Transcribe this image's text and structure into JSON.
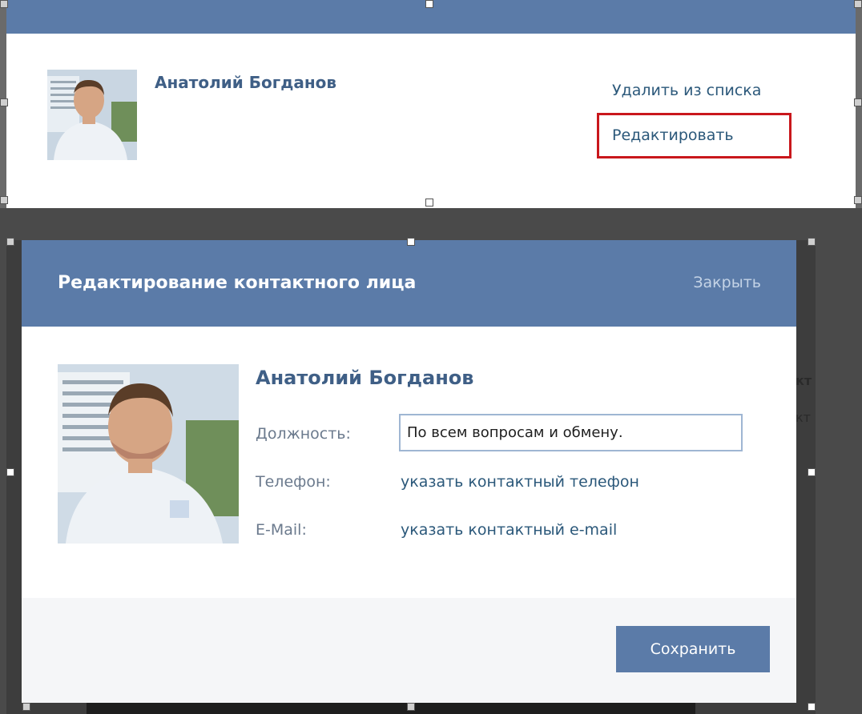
{
  "top_panel": {
    "contact_name": "Анатолий Богданов",
    "remove_link": "Удалить из списка",
    "edit_link": "Редактировать"
  },
  "dialog": {
    "title": "Редактирование контактного лица",
    "close_label": "Закрыть",
    "contact_name": "Анатолий Богданов",
    "position_label": "Должность:",
    "position_value": "По всем вопросам и обмену.",
    "phone_label": "Телефон:",
    "phone_link": "указать контактный телефон",
    "email_label": "E-Mail:",
    "email_link": "указать контактный e-mail",
    "save_label": "Сохранить"
  },
  "colors": {
    "header": "#5b7ba8",
    "link": "#2b587a",
    "highlight": "#c9171c"
  }
}
